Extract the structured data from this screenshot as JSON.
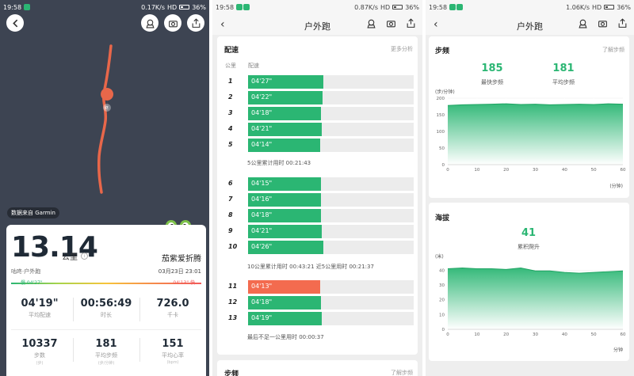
{
  "panel1": {
    "status": {
      "time": "19:58",
      "speed": "0.17K/s",
      "network": "HD",
      "battery": "36%"
    },
    "data_source": "数据来自 Garmin",
    "distance": "13.14",
    "distance_unit": "公里",
    "user_name": "茄紫爱折腾",
    "activity_type": "咕咚·户外跑",
    "date": "03月23日 23:01",
    "slow_label": "慢 04'27\"",
    "fast_label": "04'13\" 快",
    "stats_row1": [
      {
        "value": "04'19\"",
        "label": "平均配速"
      },
      {
        "value": "00:56:49",
        "label": "时长"
      },
      {
        "value": "726.0",
        "label": "千卡"
      }
    ],
    "stats_row2": [
      {
        "value": "10337",
        "label": "步数",
        "unit": "(步)"
      },
      {
        "value": "181",
        "label": "平均步频",
        "unit": "(步/分钟)"
      },
      {
        "value": "151",
        "label": "平均心率",
        "unit": "(bpm)"
      }
    ],
    "route_color": "#e8674a",
    "start_marker_text": "终"
  },
  "panel2": {
    "status": {
      "time": "19:58",
      "speed": "0.87K/s",
      "network": "HD",
      "battery": "36%"
    },
    "title": "户外跑",
    "pace_card": {
      "title": "配速",
      "more_link": "更多分析",
      "col_km": "公里",
      "col_pace": "配速",
      "splits": [
        {
          "km": "1",
          "pace": "04'27\"",
          "seconds": 267
        },
        {
          "km": "2",
          "pace": "04'22\"",
          "seconds": 262
        },
        {
          "km": "3",
          "pace": "04'18\"",
          "seconds": 258
        },
        {
          "km": "4",
          "pace": "04'21\"",
          "seconds": 261
        },
        {
          "km": "5",
          "pace": "04'14\"",
          "seconds": 254
        },
        {
          "km": "6",
          "pace": "04'15\"",
          "seconds": 255
        },
        {
          "km": "7",
          "pace": "04'16\"",
          "seconds": 256
        },
        {
          "km": "8",
          "pace": "04'18\"",
          "seconds": 258
        },
        {
          "km": "9",
          "pace": "04'21\"",
          "seconds": 261
        },
        {
          "km": "10",
          "pace": "04'26\"",
          "seconds": 266
        },
        {
          "km": "11",
          "pace": "04'13\"",
          "seconds": 253,
          "fastest": true
        },
        {
          "km": "12",
          "pace": "04'18\"",
          "seconds": 258
        },
        {
          "km": "13",
          "pace": "04'19\"",
          "seconds": 259
        }
      ],
      "note_5km": "5公里累计用时 00:21:43",
      "note_10km": "10公里累计用时 00:43:21  近5公里用时 00:21:37",
      "note_last": "最后不足一公里用时 00:00:37"
    },
    "next_card_title": "步频",
    "next_card_link": "了解步频"
  },
  "panel3": {
    "status": {
      "time": "19:58",
      "speed": "1.06K/s",
      "network": "HD",
      "battery": "36%"
    },
    "title": "户外跑",
    "cadence": {
      "title": "步频",
      "link": "了解步频",
      "max_value": "185",
      "max_label": "最快步频",
      "avg_value": "181",
      "avg_label": "平均步频",
      "y_unit": "(步/分钟)",
      "x_unit": "(分钟)",
      "chart_data": {
        "type": "area",
        "x": [
          0,
          5,
          10,
          15,
          20,
          25,
          30,
          35,
          40,
          45,
          50,
          55,
          60
        ],
        "values": [
          178,
          180,
          181,
          182,
          183,
          181,
          182,
          180,
          181,
          182,
          181,
          183,
          182
        ],
        "yticks": [
          "0",
          "50",
          "100",
          "150",
          "200"
        ],
        "xticks": [
          "0",
          "10",
          "20",
          "30",
          "40",
          "50",
          "60"
        ],
        "ylim": [
          0,
          200
        ],
        "xlim": [
          0,
          60
        ]
      }
    },
    "elevation": {
      "title": "海拔",
      "gain_value": "41",
      "gain_label": "累积爬升",
      "y_unit": "(米)",
      "x_unit": "分钟",
      "chart_data": {
        "type": "area",
        "x": [
          0,
          5,
          10,
          15,
          20,
          25,
          30,
          35,
          40,
          45,
          50,
          55,
          60
        ],
        "values": [
          41,
          41.5,
          41,
          41,
          40.5,
          41.5,
          39.5,
          39.5,
          38.5,
          38,
          38.5,
          39,
          39.5
        ],
        "yticks": [
          "0",
          "10",
          "20",
          "30",
          "40"
        ],
        "xticks": [
          "0",
          "10",
          "20",
          "30",
          "40",
          "50",
          "60"
        ],
        "ylim": [
          0,
          45
        ],
        "xlim": [
          0,
          60
        ]
      }
    }
  },
  "colors": {
    "accent": "#2bb673",
    "fastest": "#f36b4f",
    "map_bg": "#3d4452"
  }
}
